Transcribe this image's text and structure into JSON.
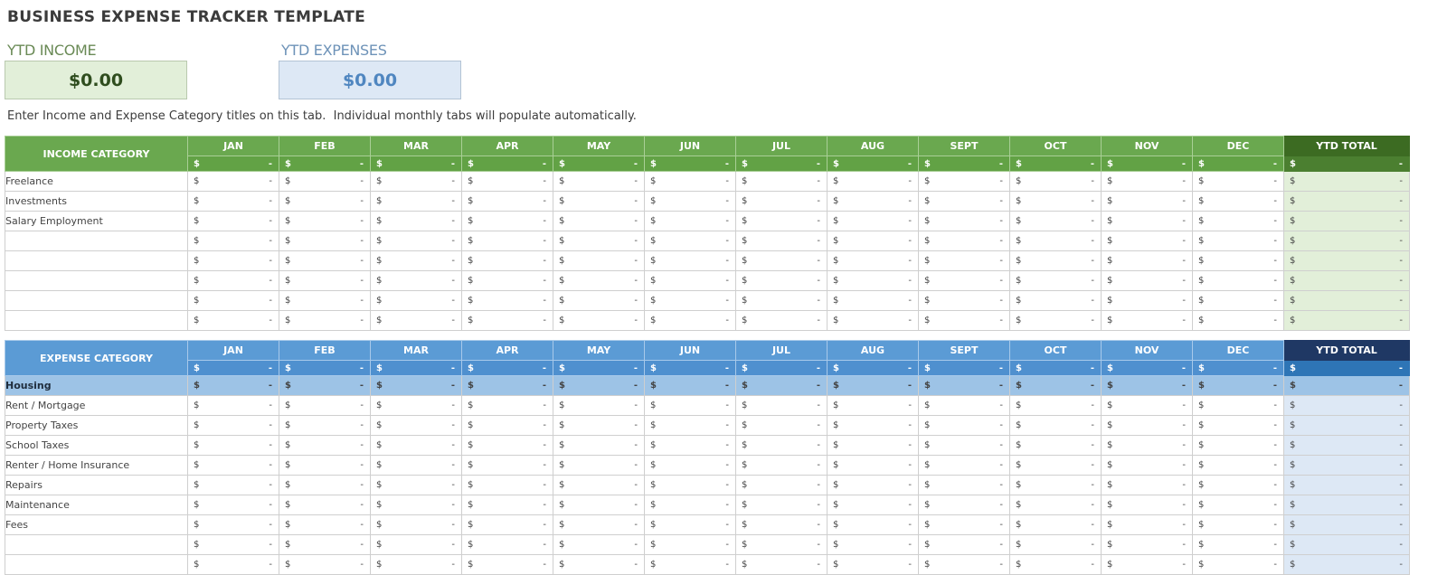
{
  "title": "BUSINESS EXPENSE TRACKER TEMPLATE",
  "kpis": {
    "income_label": "YTD INCOME",
    "income_value": "$0.00",
    "expenses_label": "YTD EXPENSES",
    "expenses_value": "$0.00"
  },
  "instructions": "Enter Income and Expense Category titles on this tab.  Individual monthly tabs will populate automatically.",
  "colors": {
    "income_header": "#6aa84f",
    "income_ytd_header": "#3c6b22",
    "income_ytd_fill": "#e2efd9",
    "expense_header": "#5b9bd5",
    "expense_ytd_header": "#1f3864",
    "expense_ytd_fill": "#dde8f5",
    "expense_group_fill": "#9dc3e6"
  },
  "months": [
    "JAN",
    "FEB",
    "MAR",
    "APR",
    "MAY",
    "JUN",
    "JUL",
    "AUG",
    "SEPT",
    "OCT",
    "NOV",
    "DEC"
  ],
  "ytd_label": "YTD TOTAL",
  "currency_symbol": "$",
  "empty_value": "-",
  "income": {
    "header": "INCOME CATEGORY",
    "rows": [
      {
        "label": "Freelance"
      },
      {
        "label": "Investments"
      },
      {
        "label": "Salary Employment"
      },
      {
        "label": ""
      },
      {
        "label": ""
      },
      {
        "label": ""
      },
      {
        "label": ""
      },
      {
        "label": ""
      }
    ]
  },
  "expense": {
    "header": "EXPENSE CATEGORY",
    "rows": [
      {
        "label": "Housing",
        "group": true
      },
      {
        "label": "Rent / Mortgage"
      },
      {
        "label": "Property Taxes"
      },
      {
        "label": "School Taxes"
      },
      {
        "label": "Renter / Home Insurance"
      },
      {
        "label": "Repairs"
      },
      {
        "label": "Maintenance"
      },
      {
        "label": "Fees"
      },
      {
        "label": ""
      },
      {
        "label": ""
      }
    ]
  }
}
